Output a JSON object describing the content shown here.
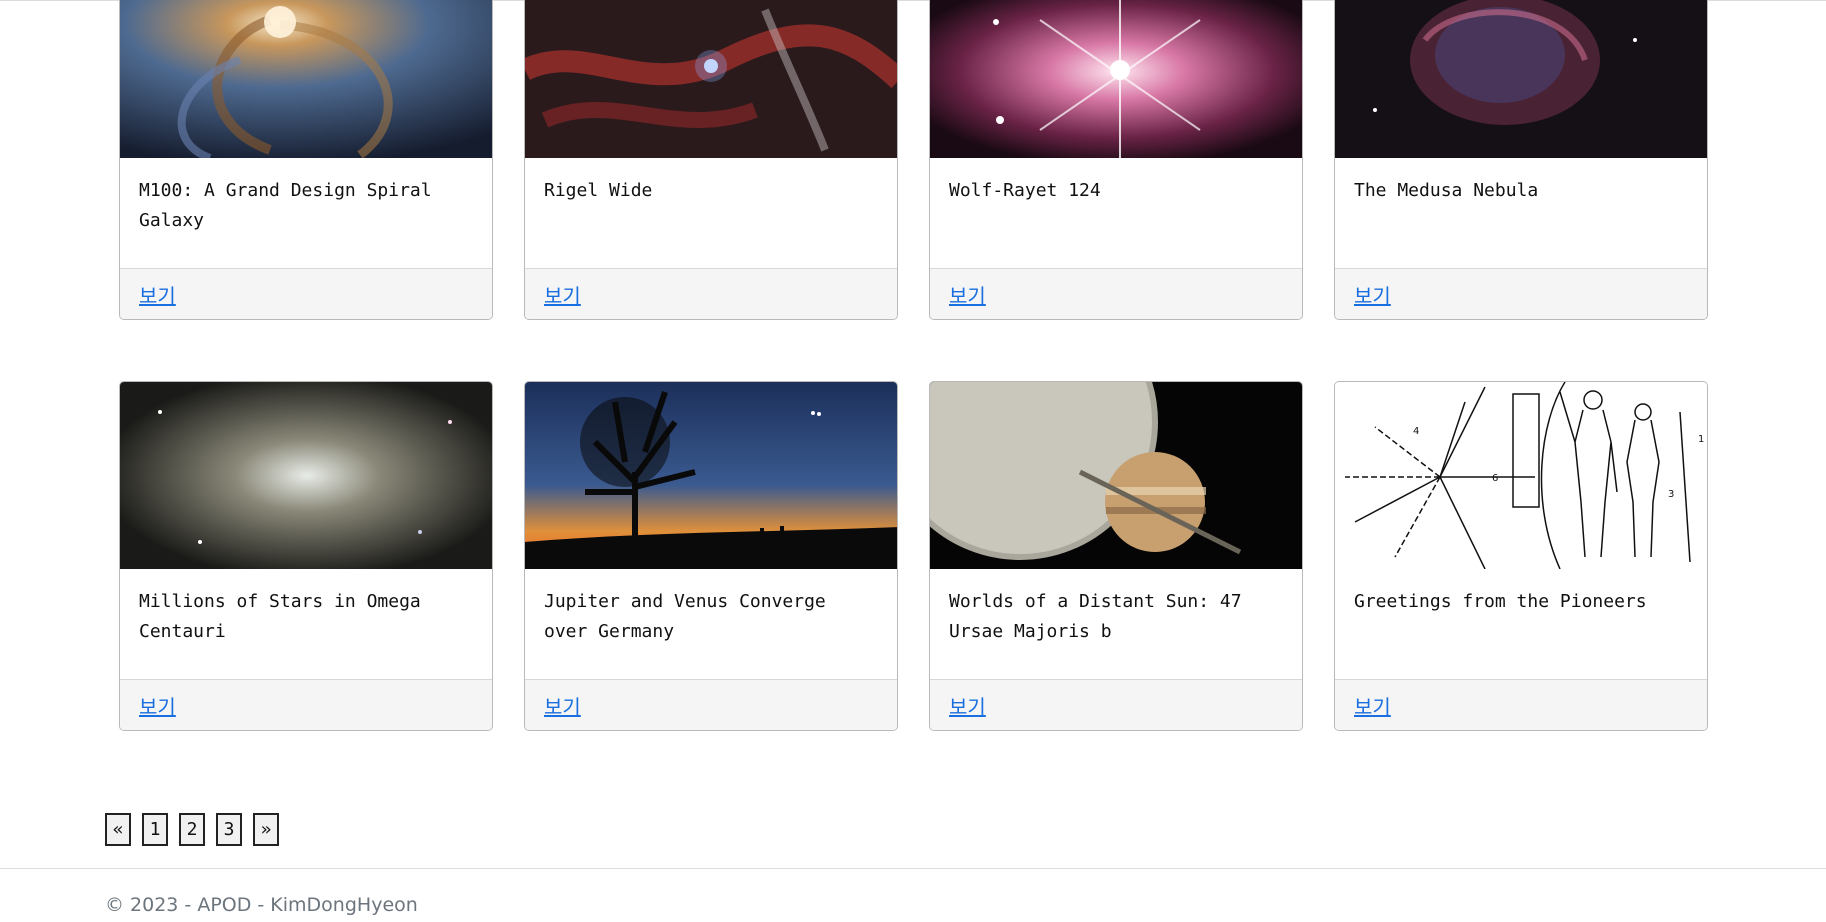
{
  "cards": [
    {
      "title": "M100: A Grand Design Spiral Galaxy",
      "link": "보기"
    },
    {
      "title": "Rigel Wide",
      "link": "보기"
    },
    {
      "title": "Wolf-Rayet 124",
      "link": "보기"
    },
    {
      "title": "The Medusa Nebula",
      "link": "보기"
    },
    {
      "title": "Millions of Stars in Omega Centauri",
      "link": "보기"
    },
    {
      "title": "Jupiter and Venus Converge over Germany",
      "link": "보기"
    },
    {
      "title": "Worlds of a Distant Sun: 47 Ursae Majoris b",
      "link": "보기"
    },
    {
      "title": "Greetings from the Pioneers",
      "link": "보기"
    }
  ],
  "pagination": {
    "prev": "«",
    "pages": [
      "1",
      "2",
      "3"
    ],
    "next": "»"
  },
  "footer": {
    "copyright": "© 2023 - APOD - KimDongHyeon"
  }
}
